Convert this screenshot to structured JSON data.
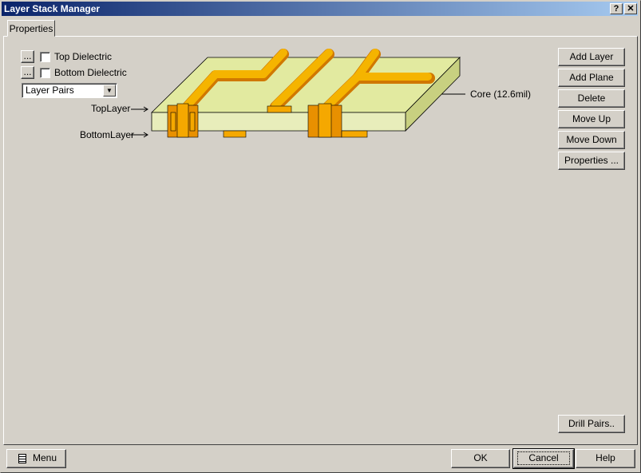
{
  "window": {
    "title": "Layer Stack Manager",
    "help_glyph": "?",
    "close_glyph": "✕"
  },
  "tabs": [
    {
      "label": "Properties"
    }
  ],
  "options": {
    "ellipsis": "...",
    "top_dielectric": "Top Dielectric",
    "bottom_dielectric": "Bottom Dielectric",
    "top_checked": false,
    "bottom_checked": false,
    "view_select": "Layer Pairs"
  },
  "diagram": {
    "top_layer": "TopLayer",
    "bottom_layer": "BottomLayer",
    "core": "Core (12.6mil)",
    "colors": {
      "board": "#e2eaa0",
      "copper": "#f5a800",
      "copper_dark": "#d07800"
    }
  },
  "side_buttons": [
    "Add Layer",
    "Add Plane",
    "Delete",
    "Move Up",
    "Move Down",
    "Properties ..."
  ],
  "drill_pairs": "Drill Pairs..",
  "footer": {
    "menu": "Menu",
    "ok": "OK",
    "cancel": "Cancel",
    "help": "Help"
  }
}
